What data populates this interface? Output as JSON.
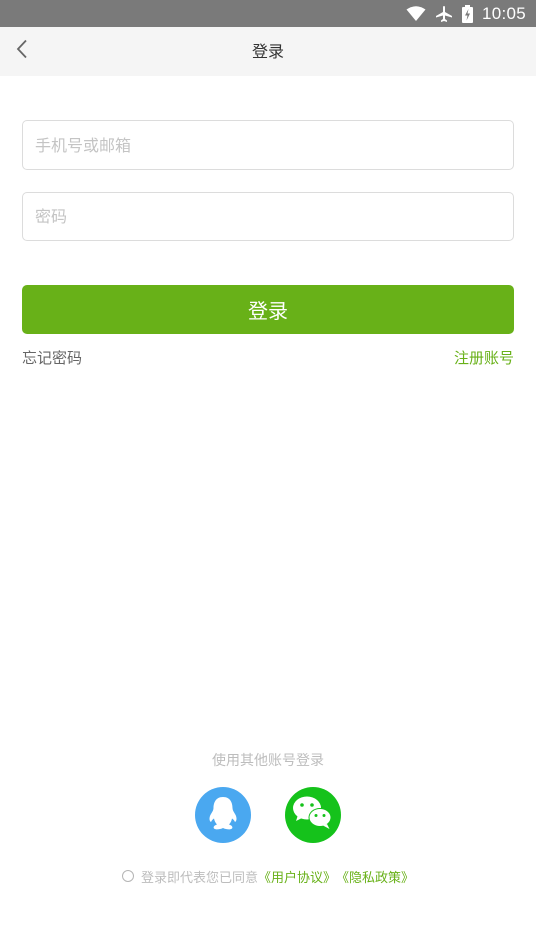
{
  "status_bar": {
    "time": "10:05",
    "icons": [
      "wifi-icon",
      "airplane-icon",
      "battery-icon"
    ]
  },
  "nav": {
    "title": "登录",
    "back_icon": "chevron-left-icon"
  },
  "form": {
    "phone_placeholder": "手机号或邮箱",
    "password_placeholder": "密码",
    "login_label": "登录",
    "forgot_label": "忘记密码",
    "register_label": "注册账号"
  },
  "social": {
    "title": "使用其他账号登录",
    "providers": [
      "qq-icon",
      "wechat-icon"
    ]
  },
  "agreement": {
    "text": "登录即代表您已同意",
    "user_agreement": "《用户协议》",
    "privacy_policy": "《隐私政策》"
  },
  "colors": {
    "accent": "#68b118",
    "status_bar": "#7a7a7a",
    "qq": "#4aa8f0",
    "wechat": "#15c21b"
  }
}
